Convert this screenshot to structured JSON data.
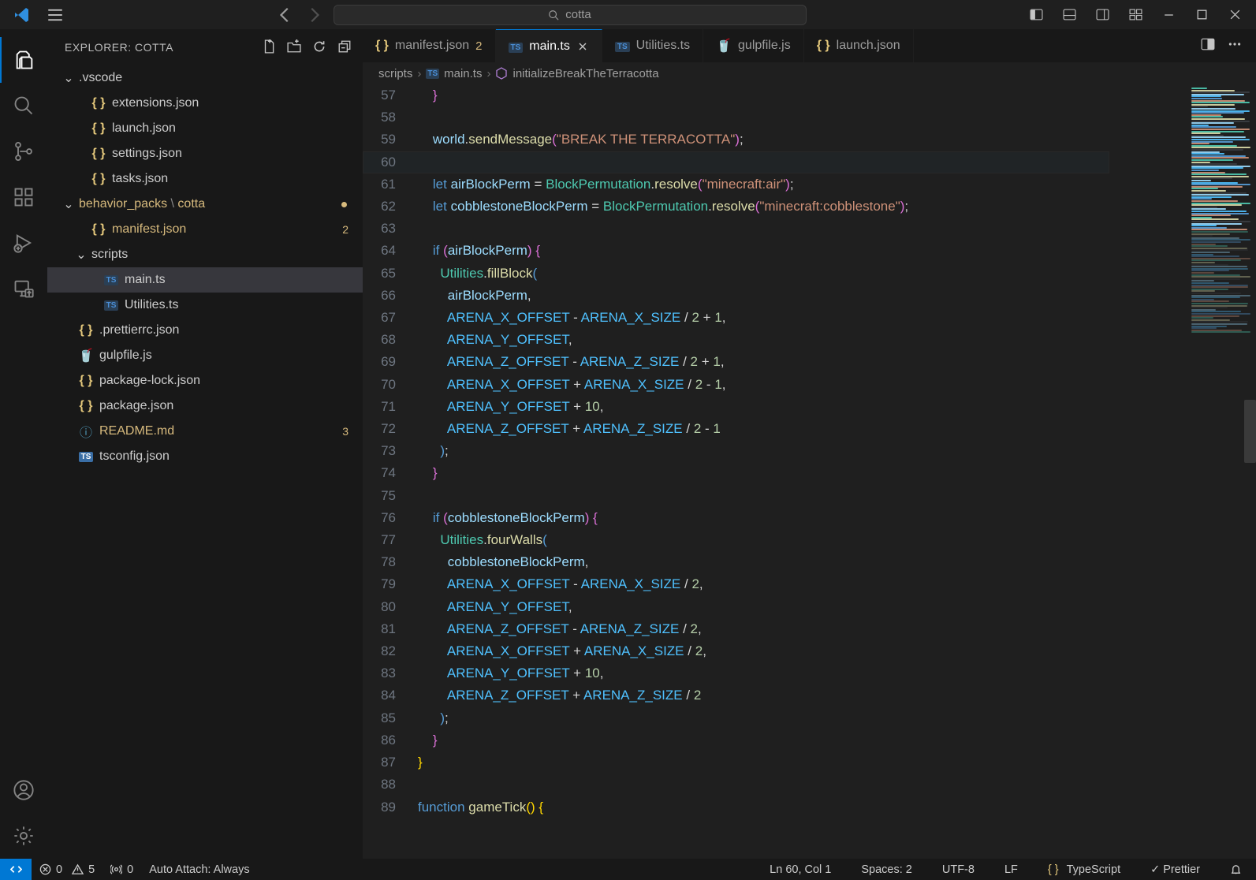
{
  "search_text": "cotta",
  "explorer": {
    "title": "EXPLORER: COTTA",
    "tree": [
      {
        "d": 0,
        "type": "folder",
        "name": ".vscode",
        "open": true
      },
      {
        "d": 1,
        "type": "json",
        "name": "extensions.json"
      },
      {
        "d": 1,
        "type": "json",
        "name": "launch.json"
      },
      {
        "d": 1,
        "type": "json",
        "name": "settings.json"
      },
      {
        "d": 1,
        "type": "json",
        "name": "tasks.json"
      },
      {
        "d": 0,
        "type": "folder",
        "name": "behavior_packs \\ cotta",
        "open": true,
        "mod": true,
        "dot": true
      },
      {
        "d": 1,
        "type": "json",
        "name": "manifest.json",
        "mod": true,
        "badge": "2"
      },
      {
        "d": 1,
        "type": "folder",
        "name": "scripts",
        "open": true
      },
      {
        "d": 2,
        "type": "ts",
        "name": "main.ts",
        "selected": true
      },
      {
        "d": 2,
        "type": "ts",
        "name": "Utilities.ts"
      },
      {
        "d": 0,
        "type": "json",
        "name": ".prettierrc.json"
      },
      {
        "d": 0,
        "type": "gulp",
        "name": "gulpfile.js"
      },
      {
        "d": 0,
        "type": "json",
        "name": "package-lock.json"
      },
      {
        "d": 0,
        "type": "json",
        "name": "package.json"
      },
      {
        "d": 0,
        "type": "md",
        "name": "README.md",
        "mod": true,
        "badge": "3"
      },
      {
        "d": 0,
        "type": "ts2",
        "name": "tsconfig.json"
      }
    ]
  },
  "tabs": [
    {
      "icon": "json",
      "label": "manifest.json",
      "mod": "2"
    },
    {
      "icon": "ts",
      "label": "main.ts",
      "active": true,
      "close": true
    },
    {
      "icon": "ts",
      "label": "Utilities.ts"
    },
    {
      "icon": "gulp",
      "label": "gulpfile.js"
    },
    {
      "icon": "json",
      "label": "launch.json"
    }
  ],
  "breadcrumbs": {
    "parts": [
      "scripts",
      "main.ts",
      "initializeBreakTheTerracotta"
    ]
  },
  "code_start": 57,
  "code": [
    "    }",
    "",
    "    world.sendMessage(\"BREAK THE TERRACOTTA\");",
    "",
    "    let airBlockPerm = BlockPermutation.resolve(\"minecraft:air\");",
    "    let cobblestoneBlockPerm = BlockPermutation.resolve(\"minecraft:cobblestone\");",
    "",
    "    if (airBlockPerm) {",
    "      Utilities.fillBlock(",
    "        airBlockPerm,",
    "        ARENA_X_OFFSET - ARENA_X_SIZE / 2 + 1,",
    "        ARENA_Y_OFFSET,",
    "        ARENA_Z_OFFSET - ARENA_Z_SIZE / 2 + 1,",
    "        ARENA_X_OFFSET + ARENA_X_SIZE / 2 - 1,",
    "        ARENA_Y_OFFSET + 10,",
    "        ARENA_Z_OFFSET + ARENA_Z_SIZE / 2 - 1",
    "      );",
    "    }",
    "",
    "    if (cobblestoneBlockPerm) {",
    "      Utilities.fourWalls(",
    "        cobblestoneBlockPerm,",
    "        ARENA_X_OFFSET - ARENA_X_SIZE / 2,",
    "        ARENA_Y_OFFSET,",
    "        ARENA_Z_OFFSET - ARENA_Z_SIZE / 2,",
    "        ARENA_X_OFFSET + ARENA_X_SIZE / 2,",
    "        ARENA_Y_OFFSET + 10,",
    "        ARENA_Z_OFFSET + ARENA_Z_SIZE / 2",
    "      );",
    "    }",
    "}",
    "",
    "function gameTick() {"
  ],
  "current_line": 60,
  "status": {
    "errors": "0",
    "warnings": "5",
    "radio": "0",
    "attach": "Auto Attach: Always",
    "lncol": "Ln 60, Col 1",
    "spaces": "Spaces: 2",
    "enc": "UTF-8",
    "eol": "LF",
    "lang": "TypeScript",
    "fmt": "Prettier"
  }
}
